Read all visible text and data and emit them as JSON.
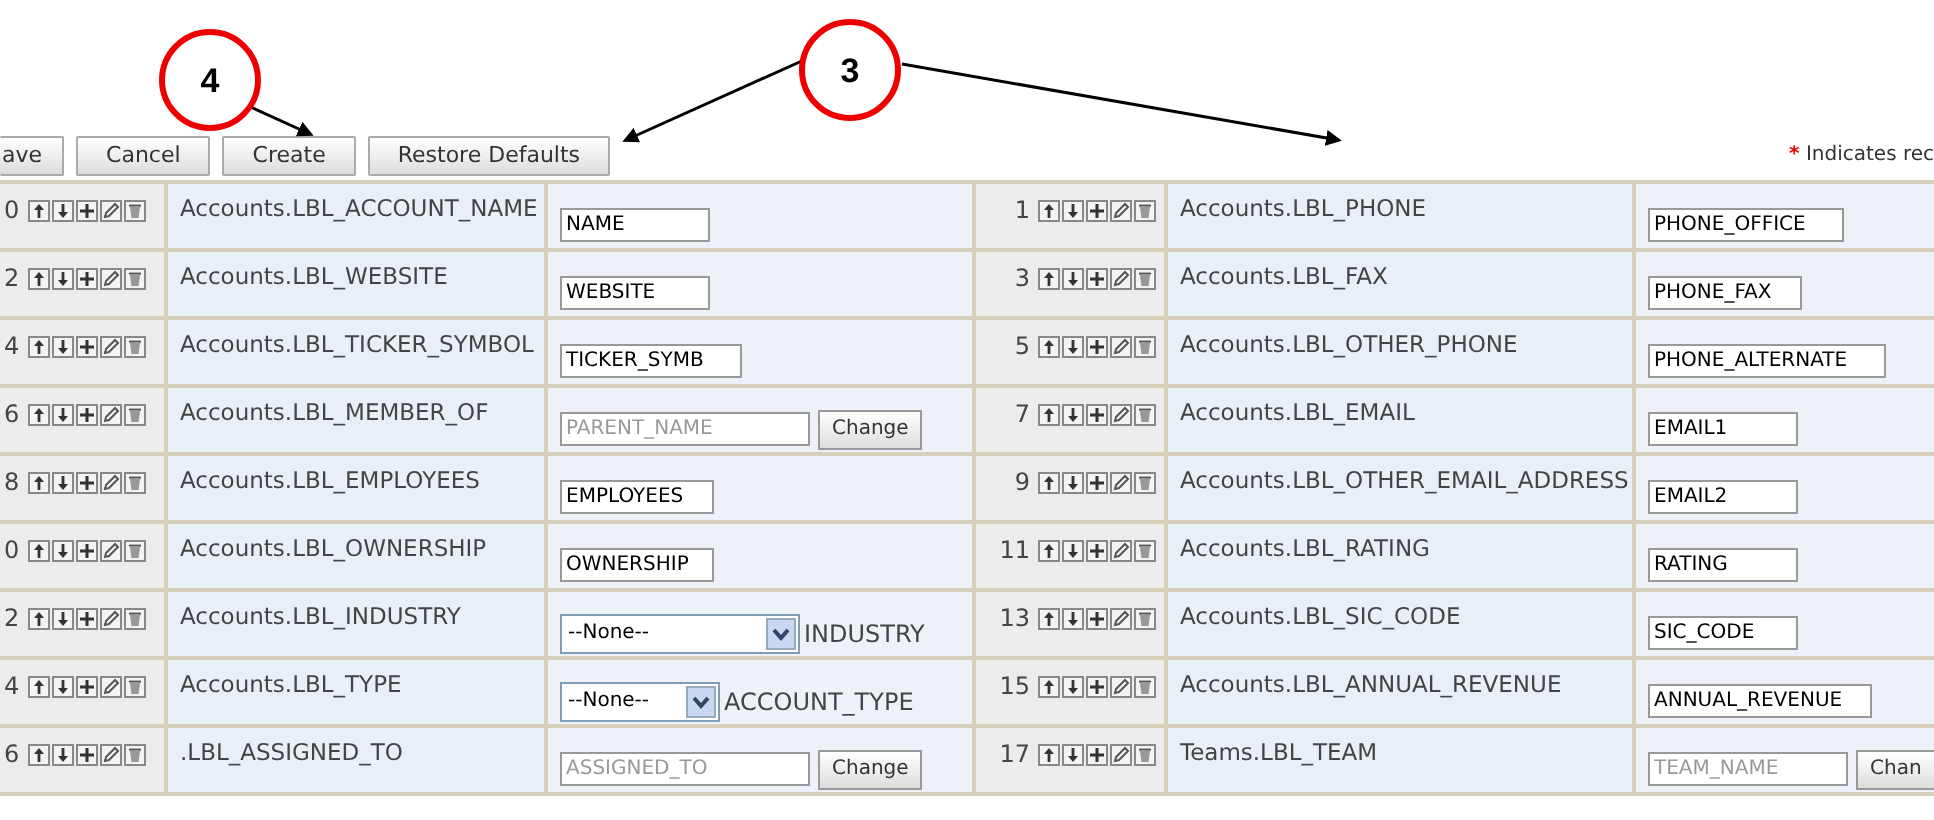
{
  "callouts": [
    {
      "label": "4"
    },
    {
      "label": "3"
    }
  ],
  "toolbar": {
    "buttons": [
      "ave",
      "Cancel",
      "Create",
      "Restore Defaults"
    ],
    "required_note": {
      "mark": "*",
      "text": "Indicates rec"
    }
  },
  "rows": [
    {
      "left": {
        "num": "0",
        "label": "Accounts.LBL_ACCOUNT_NAME",
        "field": {
          "kind": "text",
          "value": "NAME"
        }
      },
      "right": {
        "num": "1",
        "label": "Accounts.LBL_PHONE",
        "field": {
          "kind": "text",
          "value": "PHONE_OFFICE"
        }
      }
    },
    {
      "left": {
        "num": "2",
        "label": "Accounts.LBL_WEBSITE",
        "field": {
          "kind": "text",
          "value": "WEBSITE"
        }
      },
      "right": {
        "num": "3",
        "label": "Accounts.LBL_FAX",
        "field": {
          "kind": "text",
          "value": "PHONE_FAX"
        }
      }
    },
    {
      "left": {
        "num": "4",
        "label": "Accounts.LBL_TICKER_SYMBOL",
        "field": {
          "kind": "text",
          "value": "TICKER_SYMB"
        }
      },
      "right": {
        "num": "5",
        "label": "Accounts.LBL_OTHER_PHONE",
        "field": {
          "kind": "text",
          "value": "PHONE_ALTERNATE"
        }
      }
    },
    {
      "left": {
        "num": "6",
        "label": "Accounts.LBL_MEMBER_OF",
        "field": {
          "kind": "relate",
          "value": "PARENT_NAME",
          "disabled": true,
          "button": "Change"
        }
      },
      "right": {
        "num": "7",
        "label": "Accounts.LBL_EMAIL",
        "field": {
          "kind": "text",
          "value": "EMAIL1"
        }
      }
    },
    {
      "left": {
        "num": "8",
        "label": "Accounts.LBL_EMPLOYEES",
        "field": {
          "kind": "text",
          "value": "EMPLOYEES"
        }
      },
      "right": {
        "num": "9",
        "label": "Accounts.LBL_OTHER_EMAIL_ADDRESS",
        "field": {
          "kind": "text",
          "value": "EMAIL2"
        }
      }
    },
    {
      "left": {
        "num": "0",
        "label": "Accounts.LBL_OWNERSHIP",
        "field": {
          "kind": "text",
          "value": "OWNERSHIP"
        }
      },
      "right": {
        "num": "11",
        "label": "Accounts.LBL_RATING",
        "field": {
          "kind": "text",
          "value": "RATING"
        }
      }
    },
    {
      "left": {
        "num": "2",
        "label": "Accounts.LBL_INDUSTRY",
        "field": {
          "kind": "select",
          "value": "--None--",
          "suffix": "INDUSTRY"
        }
      },
      "right": {
        "num": "13",
        "label": "Accounts.LBL_SIC_CODE",
        "field": {
          "kind": "text",
          "value": "SIC_CODE"
        }
      }
    },
    {
      "left": {
        "num": "4",
        "label": "Accounts.LBL_TYPE",
        "field": {
          "kind": "select",
          "value": "--None--",
          "suffix": "ACCOUNT_TYPE"
        }
      },
      "right": {
        "num": "15",
        "label": "Accounts.LBL_ANNUAL_REVENUE",
        "field": {
          "kind": "text",
          "value": "ANNUAL_REVENUE"
        }
      }
    },
    {
      "left": {
        "num": "6",
        "label": ".LBL_ASSIGNED_TO",
        "field": {
          "kind": "relate",
          "value": "ASSIGNED_TO",
          "disabled": true,
          "button": "Change"
        }
      },
      "right": {
        "num": "17",
        "label": "Teams.LBL_TEAM",
        "field": {
          "kind": "relate",
          "value": "TEAM_NAME",
          "disabled": true,
          "button": "Chan"
        }
      }
    }
  ]
}
